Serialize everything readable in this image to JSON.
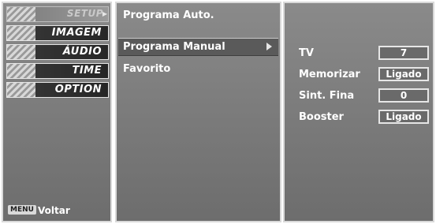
{
  "left_menu": {
    "items": [
      {
        "label": "SETUP",
        "icon": "satellite-dish-icon"
      },
      {
        "label": "IMAGEM",
        "icon": "film-icon"
      },
      {
        "label": "ÁUDIO",
        "icon": "speaker-icon"
      },
      {
        "label": "TIME",
        "icon": "clock-icon"
      },
      {
        "label": "OPTION",
        "icon": "option-disc-icon"
      }
    ],
    "menu_key": "MENU",
    "back_label": "Voltar"
  },
  "submenu": {
    "items": [
      "Programa Auto.",
      "Programa Manual",
      "Favorito"
    ],
    "selected_index": 1
  },
  "settings": {
    "rows": [
      {
        "label": "TV",
        "value": "7"
      },
      {
        "label": "Memorizar",
        "value": "Ligado"
      },
      {
        "label": "Sint. Fina",
        "value": "0"
      },
      {
        "label": "Booster",
        "value": "Ligado"
      }
    ]
  },
  "colors": {
    "panel_bg": "#7a7a7a",
    "panel_border": "#d9d9d9",
    "text": "#ffffff",
    "tab_dark": "#262626"
  }
}
